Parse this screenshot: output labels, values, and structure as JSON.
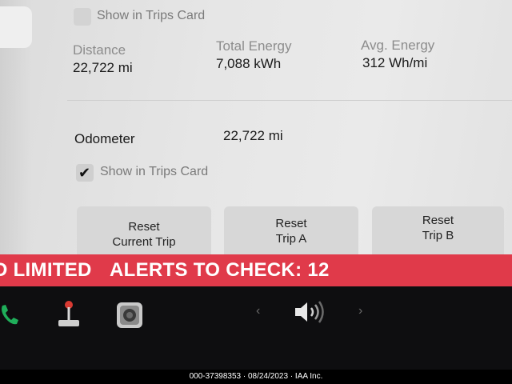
{
  "trips_card_top": {
    "label": "Show in Trips Card",
    "checked": false
  },
  "stats": [
    {
      "label": "Distance",
      "value": "22,722 mi"
    },
    {
      "label": "Total Energy",
      "value": "7,088 kWh"
    },
    {
      "label": "Avg. Energy",
      "value": "312 Wh/mi"
    }
  ],
  "odometer": {
    "label": "Odometer",
    "value": "22,722 mi"
  },
  "trips_card_odo": {
    "label": "Show in Trips Card",
    "checked": true
  },
  "buttons": {
    "reset_current": [
      "Reset",
      "Current Trip"
    ],
    "reset_a": [
      "Reset",
      "Trip A"
    ],
    "reset_b": [
      "Reset",
      "Trip B"
    ]
  },
  "alert_bar": {
    "left_text": "D LIMITED",
    "right_text": "ALERTS TO CHECK: 12",
    "color": "#e03a4a"
  },
  "dock": {
    "icons": [
      "phone-icon",
      "joystick-icon",
      "camera-icon",
      "chevron-left-icon",
      "speaker-icon",
      "chevron-right-icon"
    ],
    "chevron_left": "‹",
    "chevron_right": "›"
  },
  "footer": {
    "text": "000-37398353 · 08/24/2023 · IAA Inc."
  }
}
